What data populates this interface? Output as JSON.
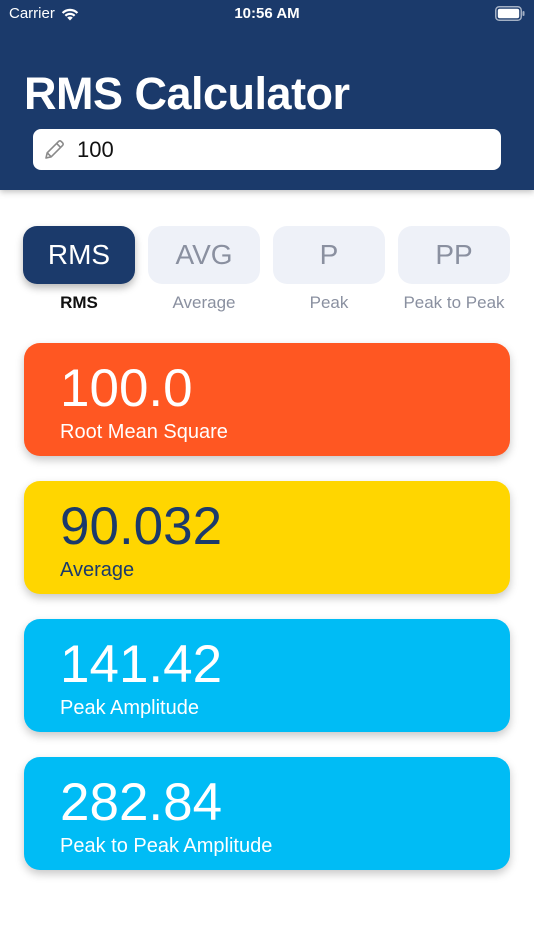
{
  "status_bar": {
    "carrier": "Carrier",
    "time": "10:56 AM"
  },
  "header": {
    "title": "RMS Calculator",
    "input_value": "100",
    "background_color": "#1b3a6b"
  },
  "tabs": [
    {
      "label": "RMS",
      "caption": "RMS",
      "active": true
    },
    {
      "label": "AVG",
      "caption": "Average",
      "active": false
    },
    {
      "label": "P",
      "caption": "Peak",
      "active": false
    },
    {
      "label": "PP",
      "caption": "Peak to Peak",
      "active": false
    }
  ],
  "results": [
    {
      "value": "100.0",
      "label": "Root Mean Square",
      "color": "#ff5722"
    },
    {
      "value": "90.032",
      "label": "Average",
      "color": "#ffd600"
    },
    {
      "value": "141.42",
      "label": "Peak Amplitude",
      "color": "#00bcf5"
    },
    {
      "value": "282.84",
      "label": "Peak to Peak Amplitude",
      "color": "#00bcf5"
    }
  ],
  "icons": {
    "wifi": "wifi-icon",
    "battery": "battery-icon",
    "input": "pencil-icon"
  }
}
